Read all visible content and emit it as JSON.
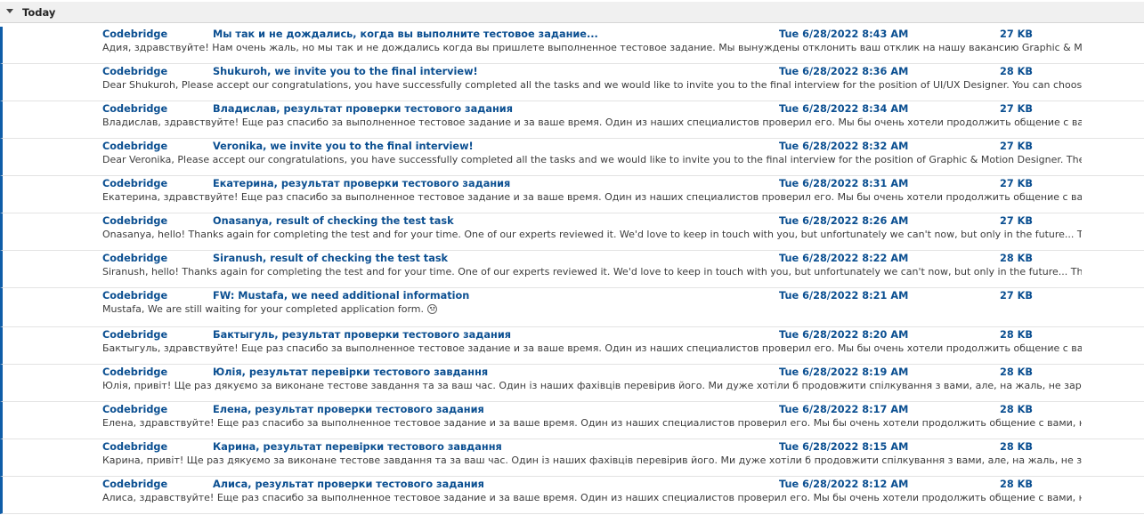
{
  "group": {
    "label": "Today"
  },
  "messages": [
    {
      "from": "Codebridge",
      "subject": "Мы так и не дождались, когда вы выполните тестовое задание...",
      "received": "Tue 6/28/2022 8:43 AM",
      "size": "27 KB",
      "preview": "Адия, здравствуйте!  Нам очень жаль, но мы так и не дождались когда вы пришлете выполненное тестовое задание.  Мы вынуждены отклонить ваш отклик на нашу вакансию Graphic & Motion Designer.  С"
    },
    {
      "from": "Codebridge",
      "subject": "Shukuroh, we invite you to the final interview!",
      "received": "Tue 6/28/2022 8:36 AM",
      "size": "28 KB",
      "preview": "Dear Shukuroh,  Please accept our congratulations, you have successfully completed all the tasks and we would like to invite you to the final interview for the position of UI/UX Designer.  You can choose who you"
    },
    {
      "from": "Codebridge",
      "subject": "Владислав, результат проверки тестового задания",
      "received": "Tue 6/28/2022 8:34 AM",
      "size": "27 KB",
      "preview": "Владислав, здравствуйте!  Еще раз спасибо за выполненное тестовое задание и за ваше время.  Один из наших специалистов проверил его.  Мы бы очень хотели продолжить общение с вами, но, к"
    },
    {
      "from": "Codebridge",
      "subject": "Veronika, we invite you to the final interview!",
      "received": "Tue 6/28/2022 8:32 AM",
      "size": "27 KB",
      "preview": "Dear Veronika,  Please accept our congratulations, you have successfully completed all the tasks and we would like to invite you to the final interview for the position of Graphic & Motion Designer.  The interviews"
    },
    {
      "from": "Codebridge",
      "subject": "Екатерина, результат проверки тестового задания",
      "received": "Tue 6/28/2022 8:31 AM",
      "size": "27 KB",
      "preview": "Екатерина, здравствуйте!  Еще раз спасибо за выполненное тестовое задание и за ваше время.  Один из наших специалистов проверил его.  Мы бы очень хотели продолжить общение с вами, но, к"
    },
    {
      "from": "Codebridge",
      "subject": "Onasanya, result of checking the test task",
      "received": "Tue 6/28/2022 8:26 AM",
      "size": "27 KB",
      "preview": "Onasanya, hello!  Thanks again for completing the test and for your time.  One of our experts reviewed it.  We'd love to keep in touch with you, but unfortunately we can't now, but only in the future... The test task"
    },
    {
      "from": "Codebridge",
      "subject": "Siranush, result of checking the test task",
      "received": "Tue 6/28/2022 8:22 AM",
      "size": "28 KB",
      "preview": "Siranush, hello!  Thanks again for completing the test and for your time.  One of our experts reviewed it.  We'd love to keep in touch with you, but unfortunately we can't now, but only in the future... The test task"
    },
    {
      "from": "Codebridge",
      "subject": "FW: Mustafa, we need additional information",
      "received": "Tue 6/28/2022 8:21 AM",
      "size": "27 KB",
      "preview": "Mustafa,  We are still waiting for your completed application form.",
      "emoji": "smiley-icon"
    },
    {
      "from": "Codebridge",
      "subject": "Бактыгуль, результат проверки тестового задания",
      "received": "Tue 6/28/2022 8:20 AM",
      "size": "28 KB",
      "preview": "Бактыгуль, здравствуйте!  Еще раз спасибо за выполненное тестовое задание и за ваше время.  Один из наших специалистов проверил его.  Мы бы очень хотели продолжить общение с вами, но, к"
    },
    {
      "from": "Codebridge",
      "subject": "Юлія, результат перевірки тестового завдання",
      "received": "Tue 6/28/2022 8:19 AM",
      "size": "28 KB",
      "preview": "Юлія, привіт!  Ще раз дякуємо за виконане тестове завдання та за ваш час.  Один із наших фахівців перевірив його.  Ми дуже хотіли б продовжити спілкування з вами, але, на жаль, не зараз, а тільки в"
    },
    {
      "from": "Codebridge",
      "subject": "Елена, результат проверки тестового задания",
      "received": "Tue 6/28/2022 8:17 AM",
      "size": "28 KB",
      "preview": "Елена, здравствуйте!  Еще раз спасибо за выполненное тестовое задание и за ваше время.  Один из наших специалистов проверил его.  Мы бы очень хотели продолжить общение с вами, но, к сожалению"
    },
    {
      "from": "Codebridge",
      "subject": "Карина, результат перевірки тестового завдання",
      "received": "Tue 6/28/2022 8:15 AM",
      "size": "28 KB",
      "preview": "Карина, привіт!  Ще раз дякуємо за виконане тестове завдання та за ваш час.  Один із наших фахівців перевірив його.  Ми дуже хотіли б продовжити спілкування з вами, але, на жаль, не зараз, а тільки в"
    },
    {
      "from": "Codebridge",
      "subject": "Алиса, результат проверки тестового задания",
      "received": "Tue 6/28/2022 8:12 AM",
      "size": "28 KB",
      "preview": "Алиса, здравствуйте!  Еще раз спасибо за выполненное тестовое задание и за ваше время.  Один из наших специалистов проверил его.  Мы бы очень хотели продолжить общение с вами, но, к сожалению"
    }
  ],
  "colors": {
    "accent": "#0b4f91",
    "unread_bar": "#0f5da8",
    "preview_text": "#3c3c3c",
    "group_bg": "#f0f0f0"
  }
}
